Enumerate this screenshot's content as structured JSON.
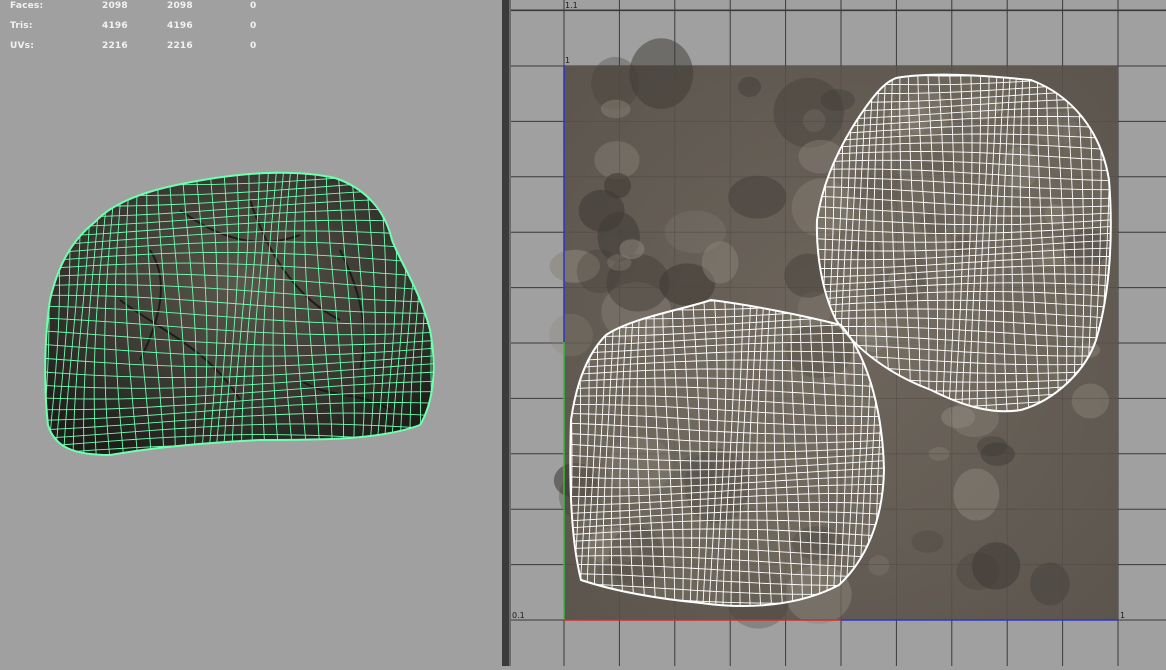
{
  "stats": {
    "rows": [
      {
        "label": "Faces:",
        "v1": "2098",
        "v2": "2098",
        "v3": "0"
      },
      {
        "label": "Tris:",
        "v1": "4196",
        "v2": "4196",
        "v3": "0"
      },
      {
        "label": "UVs:",
        "v1": "2216",
        "v2": "2216",
        "v3": "0"
      }
    ]
  },
  "uv_editor": {
    "label_top": "1.1",
    "label_top_axis": "1",
    "label_origin": "0.1",
    "label_right": "1"
  },
  "colors": {
    "background": "#a0a0a0",
    "wireframe": "#6effb0",
    "uv_wire": "#ffffff",
    "u_axis": "#d03030",
    "v_axis": "#30c030",
    "border_axis": "#2030c0"
  }
}
